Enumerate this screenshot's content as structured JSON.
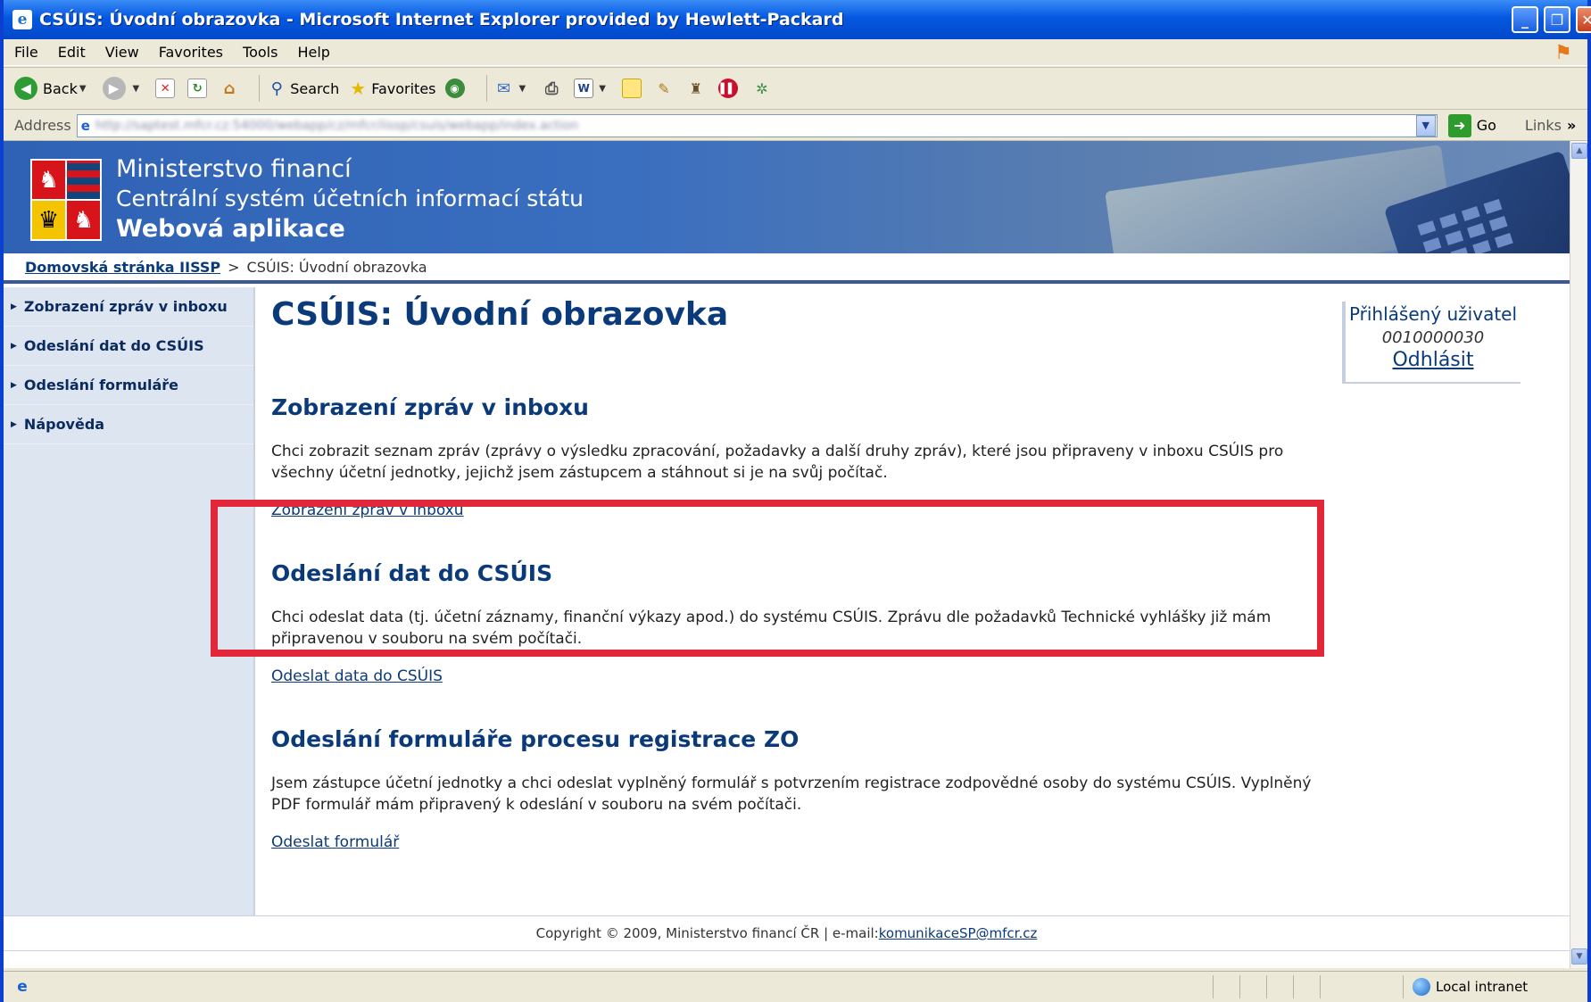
{
  "window": {
    "title": "CSÚIS: Úvodní obrazovka - Microsoft Internet Explorer provided by Hewlett-Packard"
  },
  "menu": [
    "File",
    "Edit",
    "View",
    "Favorites",
    "Tools",
    "Help"
  ],
  "toolbar": {
    "back": "Back",
    "search": "Search",
    "favorites": "Favorites"
  },
  "address": {
    "label": "Address",
    "url": "http://saptest.mfcr.cz:54000/webapp/cz/mfcr/iissp/csuis/webapp/index.action",
    "go": "Go",
    "links": "Links"
  },
  "site": {
    "org": "Ministerstvo financí",
    "system": "Centrální systém účetních informací státu",
    "app": "Webová aplikace"
  },
  "breadcrumb": {
    "home": "Domovská stránka IISSP",
    "separator": ">",
    "current": "CSÚIS: Úvodní obrazovka"
  },
  "sidebar": {
    "items": [
      {
        "label": "Zobrazení zpráv v inboxu"
      },
      {
        "label": "Odeslání dat do CSÚIS"
      },
      {
        "label": "Odeslání formuláře"
      },
      {
        "label": "Nápověda"
      }
    ]
  },
  "main": {
    "title": "CSÚIS: Úvodní obrazovka",
    "sections": [
      {
        "title": "Zobrazení zpráv v inboxu",
        "desc": "Chci zobrazit seznam zpráv (zprávy o výsledku zpracování, požadavky a další druhy zpráv), které jsou připraveny v inboxu CSÚIS pro všechny účetní jednotky, jejichž jsem zástupcem a stáhnout si je na svůj počítač.",
        "link": "Zobrazení zpráv v inboxu"
      },
      {
        "title": "Odeslání dat do CSÚIS",
        "desc": "Chci odeslat data (tj. účetní záznamy, finanční výkazy apod.) do systému CSÚIS. Zprávu dle požadavků Technické vyhlášky již mám připravenou v souboru na svém počítači.",
        "link": "Odeslat data do CSÚIS"
      },
      {
        "title": "Odeslání formuláře procesu registrace ZO",
        "desc": "Jsem zástupce účetní jednotky a chci odeslat vyplněný formulář s potvrzením registrace zodpovědné osoby do systému CSÚIS. Vyplněný PDF formulář mám připravený k odeslání v souboru na svém počítači.",
        "link": "Odeslat formulář"
      }
    ]
  },
  "user": {
    "label": "Přihlášený uživatel",
    "id": "0010000030",
    "logout": "Odhlásit"
  },
  "footer": {
    "text": "Copyright © 2009, Ministerstvo financí ČR | e-mail: ",
    "email": "komunikaceSP@mfcr.cz"
  },
  "status": {
    "zone": "Local intranet"
  },
  "colors": {
    "highlight": "#E2273A",
    "heading": "#0B3A7A",
    "header_bg": "#2F62B4"
  }
}
